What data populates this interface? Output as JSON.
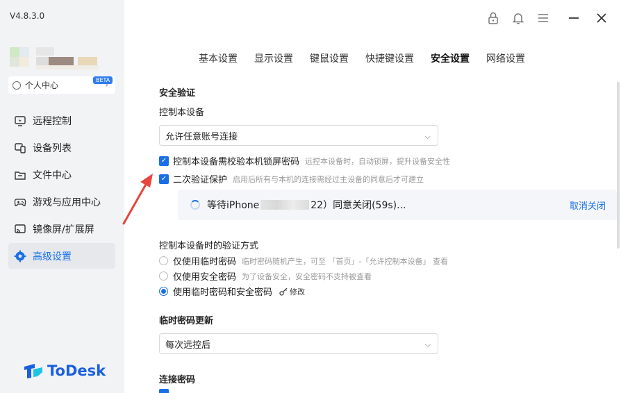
{
  "app": {
    "version": "V4.8.3.0",
    "logo_text": "ToDesk"
  },
  "sidebar": {
    "profile_label": "个人中心",
    "items": [
      {
        "label": "远程控制",
        "icon": "remote-control-icon"
      },
      {
        "label": "设备列表",
        "icon": "device-list-icon"
      },
      {
        "label": "文件中心",
        "icon": "folder-icon"
      },
      {
        "label": "游戏与应用中心",
        "icon": "gamepad-icon",
        "badge": "BETA"
      },
      {
        "label": "镜像屏/扩展屏",
        "icon": "cast-icon"
      },
      {
        "label": "高级设置",
        "icon": "gear-icon",
        "active": true
      }
    ]
  },
  "tabs": [
    {
      "label": "基本设置"
    },
    {
      "label": "显示设置"
    },
    {
      "label": "键鼠设置"
    },
    {
      "label": "快捷键设置"
    },
    {
      "label": "安全设置",
      "active": true
    },
    {
      "label": "网络设置"
    }
  ],
  "security": {
    "section_title": "安全验证",
    "control_device_label": "控制本设备",
    "control_device_select": "允许任意账号连接",
    "check1_label": "控制本设备需校验本机锁屏密码",
    "check1_hint": "远控本设备时，自动锁屏，提升设备安全性",
    "check2_label": "二次验证保护",
    "check2_hint": "启用后所有与本机的连接需经过主设备的同意后才可建立",
    "pending_prefix": "等待iPhone",
    "pending_suffix": "22）同意关闭(59s)...",
    "pending_cancel": "取消关闭",
    "auth_method_title": "控制本设备时的验证方式",
    "radio1_label": "仅使用临时密码",
    "radio1_hint": "临时密码随机产生，可至 「首页」-「允许控制本设备」 查看",
    "radio2_label": "仅使用安全密码",
    "radio2_hint": "为了设备安全，安全密码不支持被查看",
    "radio3_label": "使用临时密码和安全密码",
    "radio3_edit": "修改",
    "temp_pwd_title": "临时密码更新",
    "temp_pwd_select": "每次远控后",
    "conn_pwd_title": "连接密码"
  },
  "colors": {
    "accent": "#1a6fe8",
    "sidebar_bg": "#f2f3f5",
    "annotation_arrow": "#e8453c"
  }
}
